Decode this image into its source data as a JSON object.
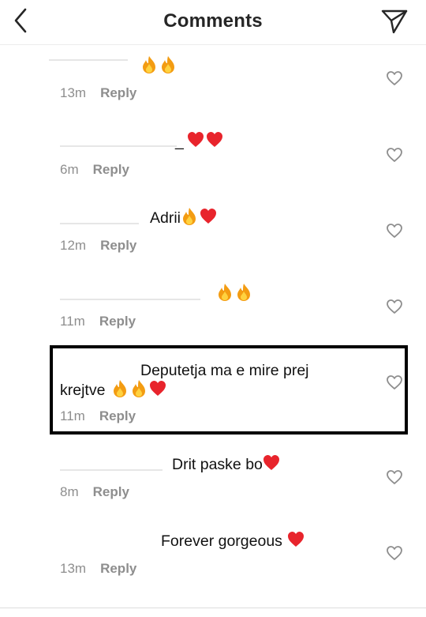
{
  "header": {
    "title": "Comments"
  },
  "reply_label": "Reply",
  "comments": [
    {
      "text": "",
      "emojis": [
        "fire",
        "fire"
      ],
      "time": "13m"
    },
    {
      "text": "_",
      "emojis": [
        "heart",
        "heart"
      ],
      "time": "6m"
    },
    {
      "text": "Adrii",
      "emojis": [
        "fire",
        "heart"
      ],
      "time": "12m"
    },
    {
      "text": "",
      "emojis": [
        "fire",
        "fire"
      ],
      "time": "11m"
    },
    {
      "text": "Deputetja ma e mire prej",
      "text2": "krejtve",
      "emojis": [
        "fire",
        "fire",
        "heart"
      ],
      "time": "11m"
    },
    {
      "text": "Drit paske bo",
      "emojis": [
        "heart"
      ],
      "time": "8m"
    },
    {
      "text": "Forever gorgeous",
      "emojis": [
        "heart"
      ],
      "time": "13m"
    }
  ],
  "colors": {
    "text": "#111111",
    "meta": "#8e8e8e",
    "heart_emoji": "#e8242c",
    "fire_emoji": "#f39c12",
    "highlight_border": "#000000"
  }
}
